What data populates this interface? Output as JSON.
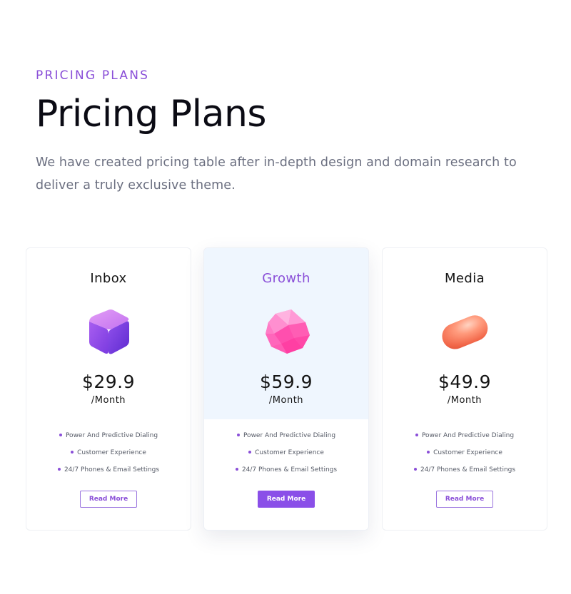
{
  "header": {
    "eyebrow": "PRICING PLANS",
    "title": "Pricing Plans",
    "subtitle": "We have created pricing table after in-depth design and domain research to deliver a truly exclusive theme."
  },
  "colors": {
    "accent": "#8a4fd8",
    "featured_bg": "#eff6fe"
  },
  "plans": [
    {
      "name": "Inbox",
      "icon": "purple-cube-icon",
      "price": "$29.9",
      "period": "/Month",
      "features": [
        "Power And Predictive Dialing",
        "Customer Experience",
        "24/7 Phones & Email Settings"
      ],
      "button": "Read More"
    },
    {
      "name": "Growth",
      "icon": "pink-gem-icon",
      "price": "$59.9",
      "period": "/Month",
      "features": [
        "Power And Predictive Dialing",
        "Customer Experience",
        "24/7 Phones & Email Settings"
      ],
      "button": "Read More"
    },
    {
      "name": "Media",
      "icon": "orange-capsule-icon",
      "price": "$49.9",
      "period": "/Month",
      "features": [
        "Power And Predictive Dialing",
        "Customer Experience",
        "24/7 Phones & Email Settings"
      ],
      "button": "Read More"
    }
  ]
}
